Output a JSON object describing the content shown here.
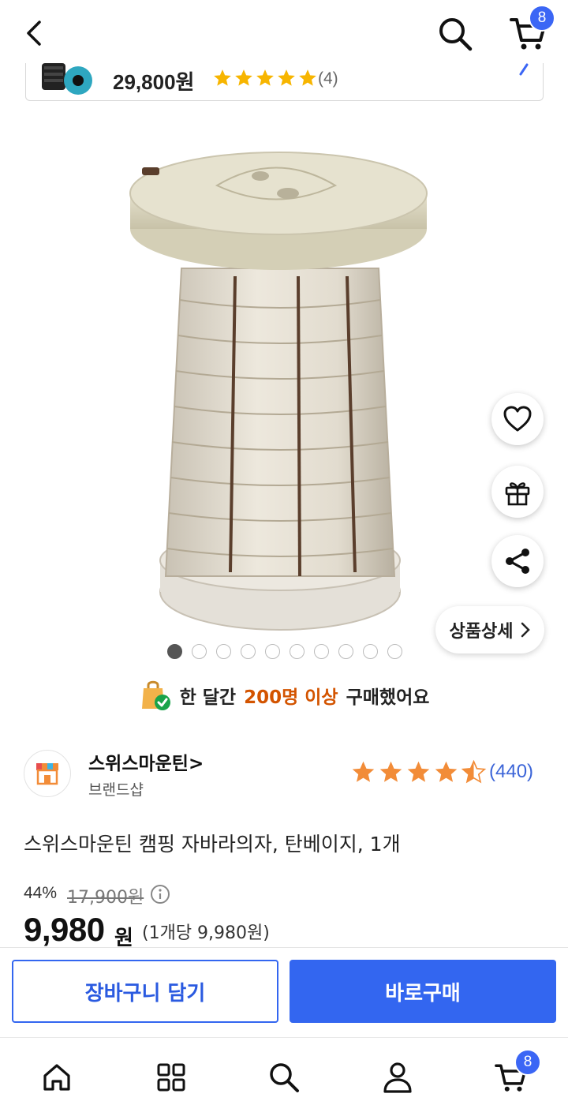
{
  "header": {
    "cart_badge": "8",
    "icons": [
      "back-arrow-icon",
      "search-icon",
      "cart-icon"
    ]
  },
  "related_product": {
    "price": "29,800원",
    "rating_stars": 5,
    "review_count": "(4)"
  },
  "gallery": {
    "image_count": 10,
    "active_index": 0,
    "detail_button_label": "상품상세"
  },
  "purchase_banner": {
    "prefix": "한 달간",
    "highlight": "200명 이상",
    "suffix": "구매했어요"
  },
  "brand": {
    "name": "스위스마운틴>",
    "subtitle": "브랜드샵"
  },
  "rating": {
    "stars": 4.5,
    "count": "(440)"
  },
  "product": {
    "title": "스위스마운틴 캠핑 자바라의자, 탄베이지, 1개",
    "discount": "44%",
    "original_price": "17,900원",
    "sale_price": "9,980",
    "sale_unit": "원",
    "unit_price": "(1개당 9,980원)"
  },
  "actions": {
    "add_to_cart": "장바구니 담기",
    "buy_now": "바로구매"
  },
  "bottom_nav": {
    "cart_badge": "8",
    "items": [
      "home-icon",
      "categories-icon",
      "search-icon",
      "my-account-icon",
      "cart-icon"
    ]
  },
  "colors": {
    "accent_blue": "#3366f0",
    "star_orange": "#f28c38",
    "star_gold": "#f7b500",
    "highlight_orange": "#d35400"
  }
}
